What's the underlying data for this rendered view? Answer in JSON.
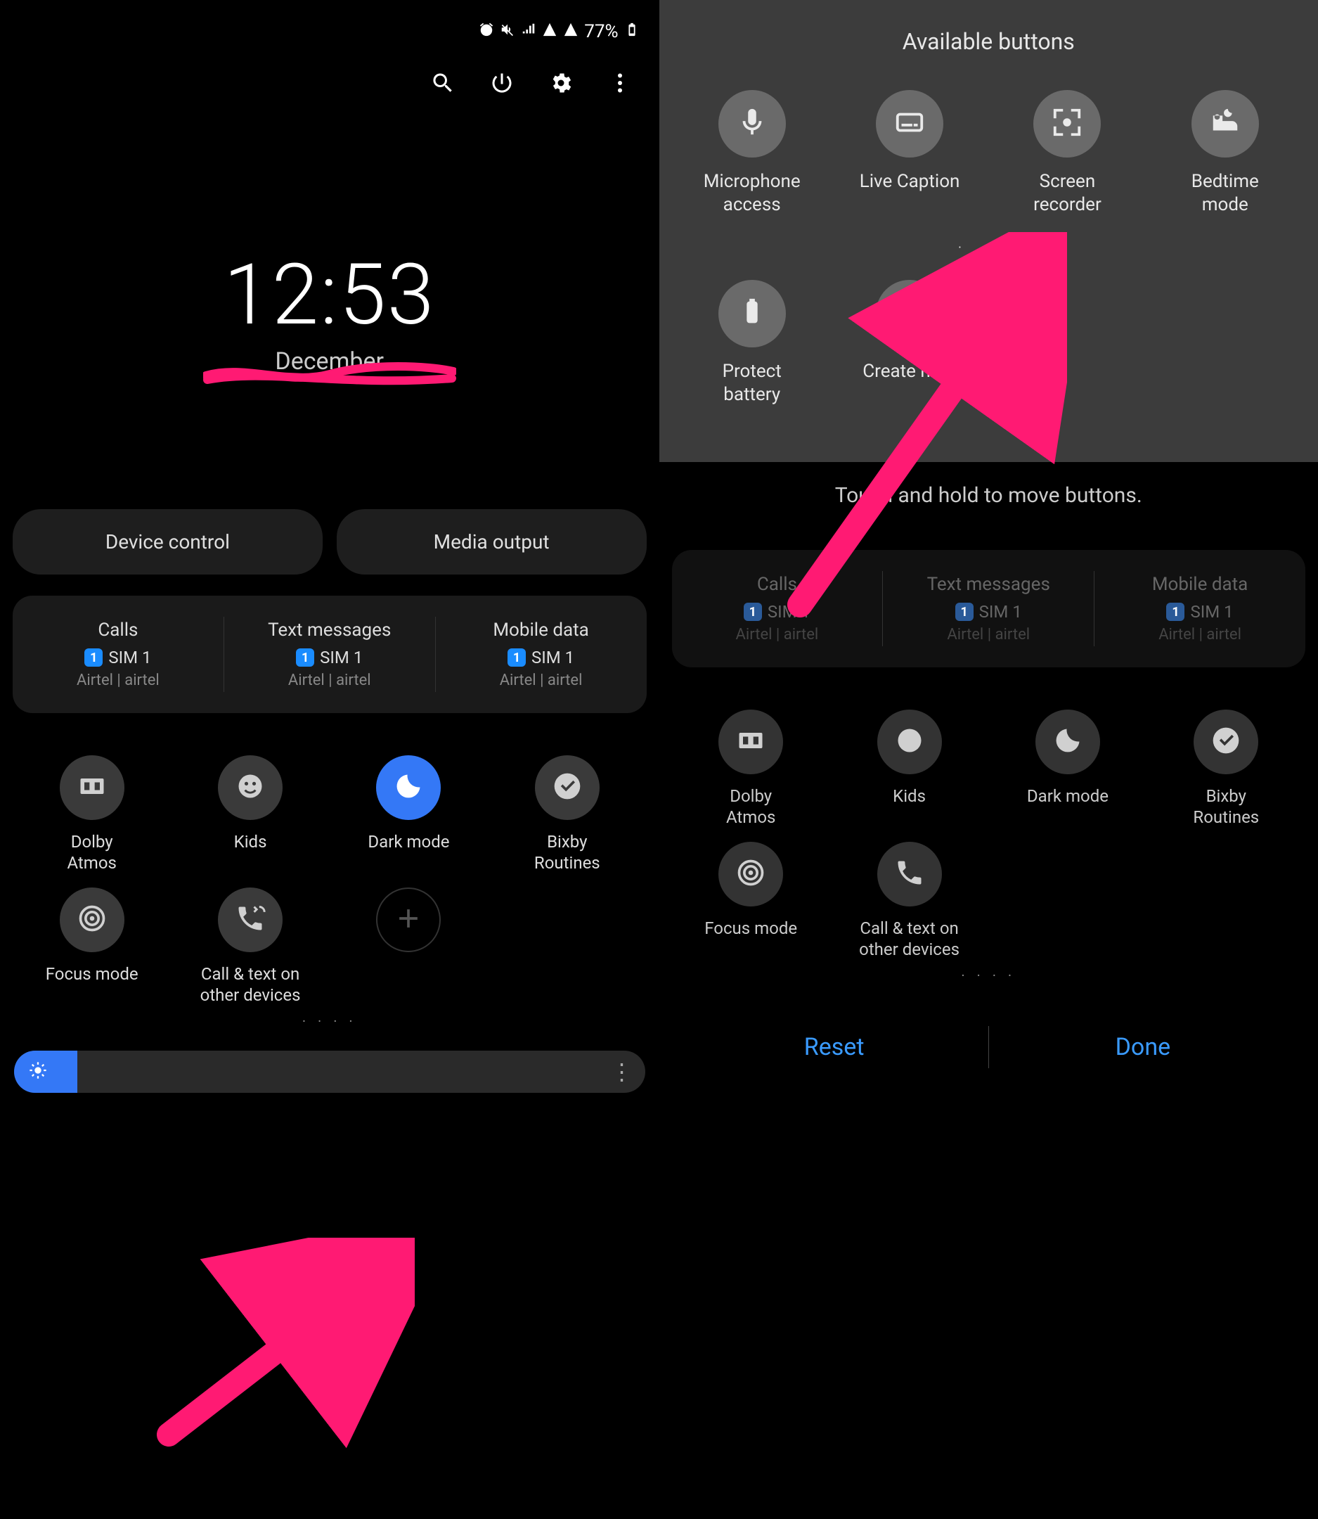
{
  "statusbar": {
    "battery": "77%"
  },
  "clock": {
    "time": "12:53",
    "date": "December"
  },
  "pills": {
    "device_control": "Device control",
    "media_output": "Media output"
  },
  "sim": {
    "cols": [
      {
        "title": "Calls",
        "badge": "1",
        "name": "SIM 1",
        "carrier": "Airtel | airtel"
      },
      {
        "title": "Text messages",
        "badge": "1",
        "name": "SIM 1",
        "carrier": "Airtel | airtel"
      },
      {
        "title": "Mobile data",
        "badge": "1",
        "name": "SIM 1",
        "carrier": "Airtel | airtel"
      }
    ]
  },
  "tiles": {
    "dolby": "Dolby\nAtmos",
    "kids": "Kids",
    "dark": "Dark mode",
    "bixby": "Bixby\nRoutines",
    "focus": "Focus mode",
    "calltext": "Call & text on\nother devices"
  },
  "available": {
    "title": "Available buttons",
    "items": {
      "mic": "Microphone\naccess",
      "caption": "Live Caption",
      "screenrec": "Screen\nrecorder",
      "bedtime": "Bedtime\nmode",
      "protect": "Protect\nbattery",
      "createnote": "Create note"
    },
    "hint": "Touch and hold to move buttons."
  },
  "bottom": {
    "reset": "Reset",
    "done": "Done"
  },
  "dots": "· · · ·"
}
